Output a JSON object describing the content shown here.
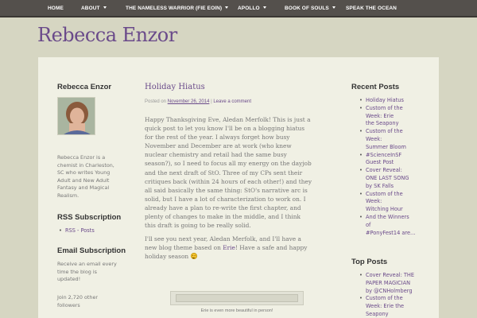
{
  "nav": {
    "items": [
      {
        "label": "HOME",
        "dropdown": false
      },
      {
        "label": "ABOUT",
        "dropdown": true
      },
      {
        "label": "THE NAMELESS WARRIOR (FIE EOIN)",
        "dropdown": true
      },
      {
        "label": "APOLLO",
        "dropdown": true
      },
      {
        "label": "BOOK OF SOULS",
        "dropdown": true
      },
      {
        "label": "SPEAK THE OCEAN",
        "dropdown": false
      }
    ]
  },
  "site": {
    "title": "Rebecca Enzor"
  },
  "left_sidebar": {
    "about_heading": "Rebecca Enzor",
    "bio_lines": [
      "Rebecca Enzor is a",
      "chemist in Charleston,",
      "SC who writes Young",
      "Adult and New Adult",
      "Fantasy and Magical",
      "Realism."
    ],
    "rss_heading": "RSS Subscription",
    "rss_link": "RSS - Posts",
    "email_heading": "Email Subscription",
    "email_lines": [
      "Receive an email every",
      "time the blog is",
      "updated!"
    ],
    "followers_lines": [
      "Join 2,720 other",
      "followers"
    ]
  },
  "post": {
    "title": "Holiday Hiatus",
    "meta_prefix": "Posted on",
    "date": "November 26, 2014",
    "separator": "|",
    "comment_link": "Leave a comment",
    "paragraph1_lines": [
      "Happy Thanksgiving Eve, Aledan Merfolk! This is just a",
      "quick post to let you know I'll be on a blogging hiatus",
      "for the rest of the year. I always forget how busy",
      "November and December are at work (who knew",
      "nuclear chemistry and retail had the same busy",
      "season?), so I need to focus all my energy on the dayjob",
      "and the next draft of StO. Three of my CPs sent their",
      "critiques back (within 24 hours of each other!) and they",
      "all said basically the same thing: StO's narrative arc is",
      "solid, but I have a lot of characterization to work on. I",
      "already have a plan to re-write the first chapter, and",
      "plenty of changes to make in the middle, and I think",
      "this draft is going to be really solid."
    ],
    "paragraph2_line1": "I'll see you next year, Aledan Merfolk, and I'll have a",
    "paragraph2_line2_pre": "new blog theme based on ",
    "paragraph2_link": "Erie",
    "paragraph2_line2_post": "! Have a safe and happy",
    "paragraph2_line3": "holiday season",
    "image_caption": "Erie is even more beautiful in person!"
  },
  "right_sidebar": {
    "recent_heading": "Recent Posts",
    "recent_posts": [
      [
        "Holiday Hiatus"
      ],
      [
        "Custom of the",
        "Week: Erie",
        "the Seapony"
      ],
      [
        "Custom of the",
        "Week:",
        "Summer Bloom"
      ],
      [
        "#ScienceInSF",
        "Guest Post"
      ],
      [
        "Cover Reveal:",
        "ONE LAST SONG",
        "by SK Falls"
      ],
      [
        "Custom of the",
        "Week:",
        "Witching Hour"
      ],
      [
        "And the Winners",
        "of",
        "#PonyFest14 are…"
      ]
    ],
    "top_heading": "Top Posts",
    "top_posts": [
      [
        "Cover Reveal: THE",
        "PAPER MAGICIAN",
        "by @CNHolmberg"
      ],
      [
        "Custom of the",
        "Week: Erie the",
        "Seapony"
      ]
    ]
  }
}
